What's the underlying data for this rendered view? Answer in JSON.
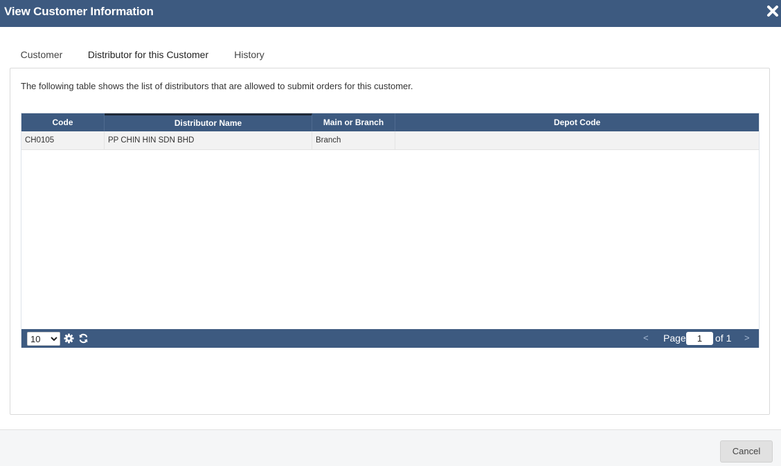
{
  "window": {
    "title": "View Customer Information"
  },
  "tabs": [
    {
      "label": "Customer"
    },
    {
      "label": "Distributor for this Customer",
      "active": true
    },
    {
      "label": "History"
    }
  ],
  "panel": {
    "description": "The following table shows the list of distributors that are allowed to submit orders for this customer."
  },
  "table": {
    "columns": [
      "Code",
      "Distributor Name",
      "Main or Branch",
      "Depot Code"
    ],
    "rows": [
      {
        "code": "CH0105",
        "distributor_name": "PP CHIN HIN SDN BHD",
        "main_or_branch": "Branch",
        "depot_code": ""
      }
    ],
    "sorted_column": "Distributor Name"
  },
  "pager": {
    "page_size": "10",
    "page_size_options": [
      "10"
    ],
    "prev_label": "<",
    "next_label": ">",
    "page_label": "Page",
    "current_page": "1",
    "of_label": "of 1"
  },
  "footer": {
    "cancel_label": "Cancel"
  },
  "colors": {
    "header_bg": "#3d5a80",
    "accent_dark": "#1f2a38"
  },
  "icons": [
    "close-icon",
    "gear-icon",
    "refresh-icon"
  ]
}
